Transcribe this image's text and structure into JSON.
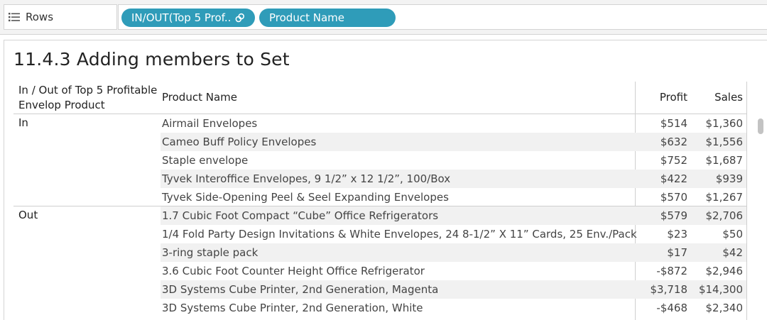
{
  "shelf": {
    "label": "Rows",
    "pills": [
      "IN/OUT(Top 5 Prof..",
      "Product Name"
    ]
  },
  "sheet": {
    "title": "11.4.3 Adding members to Set",
    "headers": {
      "group": "In / Out of Top 5 Profitable Envelop Product",
      "product": "Product Name",
      "profit": "Profit",
      "sales": "Sales"
    },
    "groups": [
      {
        "label": "In",
        "rows": [
          {
            "product": "Airmail Envelopes",
            "profit": "$514",
            "sales": "$1,360"
          },
          {
            "product": "Cameo Buff Policy Envelopes",
            "profit": "$632",
            "sales": "$1,556"
          },
          {
            "product": "Staple envelope",
            "profit": "$752",
            "sales": "$1,687"
          },
          {
            "product": "Tyvek Interoffice Envelopes, 9 1/2” x 12 1/2”, 100/Box",
            "profit": "$422",
            "sales": "$939"
          },
          {
            "product": "Tyvek Side-Opening Peel & Seel Expanding Envelopes",
            "profit": "$570",
            "sales": "$1,267"
          }
        ]
      },
      {
        "label": "Out",
        "rows": [
          {
            "product": "1.7 Cubic Foot Compact “Cube” Office Refrigerators",
            "profit": "$579",
            "sales": "$2,706"
          },
          {
            "product": "1/4 Fold Party Design Invitations & White Envelopes, 24 8-1/2” X 11” Cards, 25 Env./Pack",
            "profit": "$23",
            "sales": "$50"
          },
          {
            "product": "3-ring staple pack",
            "profit": "$17",
            "sales": "$42"
          },
          {
            "product": "3.6 Cubic Foot Counter Height Office Refrigerator",
            "profit": "-$872",
            "sales": "$2,946"
          },
          {
            "product": "3D Systems Cube Printer, 2nd Generation, Magenta",
            "profit": "$3,718",
            "sales": "$14,300"
          },
          {
            "product": "3D Systems Cube Printer, 2nd Generation, White",
            "profit": "-$468",
            "sales": "$2,340"
          }
        ]
      }
    ]
  },
  "colors": {
    "pill": "#2f9cb9",
    "band": "#f1f1f1",
    "gridline": "#cfcfcf"
  },
  "icons": {
    "rows": "rows-list-icon",
    "set": "set-link-icon"
  }
}
